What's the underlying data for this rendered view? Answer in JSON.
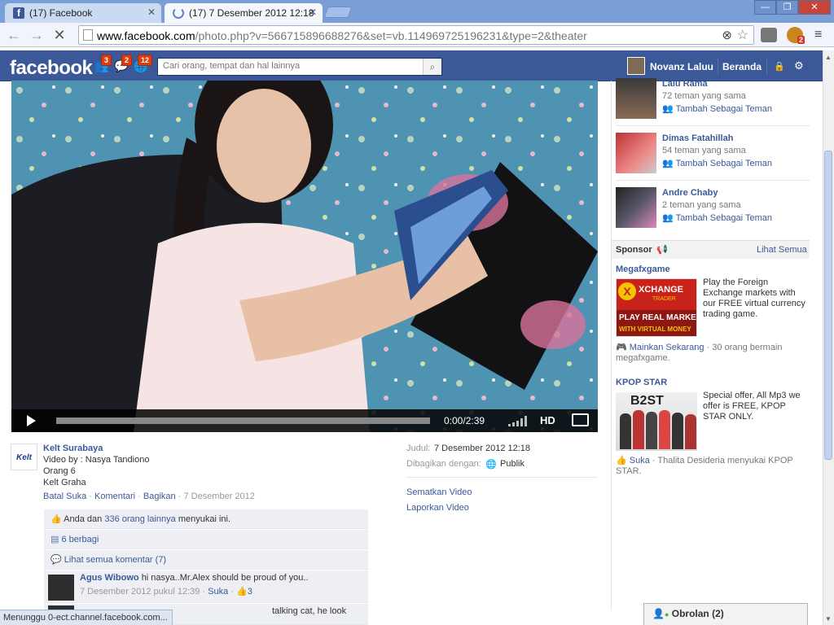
{
  "browser": {
    "tabs": [
      {
        "label": "(17) Facebook",
        "active": false
      },
      {
        "label": "(17) 7 Desember 2012 12:18",
        "active": true
      }
    ],
    "url_host": "www.facebook.com",
    "url_rest": "/photo.php?v=566715896688276&set=vb.114969725196231&type=2&theater",
    "extension_badge": "2",
    "status": "Menunggu 0-ect.channel.facebook.com..."
  },
  "fb": {
    "logo": "facebook",
    "badges": {
      "friends": "3",
      "messages": "2",
      "notifications": "12"
    },
    "search_placeholder": "Cari orang, tempat dan hal lainnya",
    "user_name": "Novanz Laluu",
    "home_label": "Beranda"
  },
  "video": {
    "time": "0:00/2:39",
    "hd_label": "HD",
    "progress": 0
  },
  "post": {
    "author": "Kelt Surabaya",
    "avatar_text": "Kelt",
    "lines": [
      "Video by : Nasya Tandiono",
      "Orang 6",
      "Kelt Graha"
    ],
    "actions": {
      "unlike": "Batal Suka",
      "comment": "Komentari",
      "share": "Bagikan",
      "date": "7 Desember 2012"
    },
    "meta": {
      "title_label": "Judul:",
      "title_value": "7 Desember 2012 12:18",
      "shared_label": "Dibagikan dengan:",
      "shared_value": "Publik",
      "embed": "Sematkan Video",
      "report": "Laporkan Video"
    },
    "likes_prefix": "Anda dan",
    "likes_link": "336 orang lainnya",
    "likes_suffix": "menyukai ini.",
    "shares": "6 berbagi",
    "view_comments": "Lihat semua komentar (7)",
    "comments": [
      {
        "author": "Agus Wibowo",
        "text": "hi nasya..Mr.Alex should be proud of you..",
        "time": "7 Desember 2012 pukul 12:39",
        "like": "Suka",
        "likes": "3"
      },
      {
        "author": "",
        "text": "talking cat, he look",
        "time": "",
        "like": "",
        "likes": ""
      }
    ]
  },
  "sidebar": {
    "suggestions": [
      {
        "name": "Lalu Rama",
        "mutual": "72 teman yang sama",
        "add": "Tambah Sebagai Teman"
      },
      {
        "name": "Dimas Fatahillah",
        "mutual": "54 teman yang sama",
        "add": "Tambah Sebagai Teman"
      },
      {
        "name": "Andre Chaby",
        "mutual": "2 teman yang sama",
        "add": "Tambah Sebagai Teman"
      }
    ],
    "sponsor_label": "Sponsor",
    "see_all": "Lihat Semua",
    "ads": [
      {
        "title": "Megafxgame",
        "body": "Play the Foreign Exchange markets with our FREE virtual currency trading game.",
        "img_top": "XCHANGE",
        "img_sub": "TRADER",
        "img_line1": "PLAY REAL MARKETS",
        "img_line2": "WITH VIRTUAL MONEY",
        "action": "Mainkan Sekarang",
        "social": "· 30 orang bermain megafxgame."
      },
      {
        "title": "KPOP STAR",
        "body": "Special offer, All Mp3 we offer is FREE, KPOP STAR ONLY.",
        "img_text": "B2ST",
        "action": "Suka",
        "social": "· Thalita Desideria menyukai KPOP STAR."
      }
    ]
  },
  "chat": {
    "label": "Obrolan (2)"
  }
}
